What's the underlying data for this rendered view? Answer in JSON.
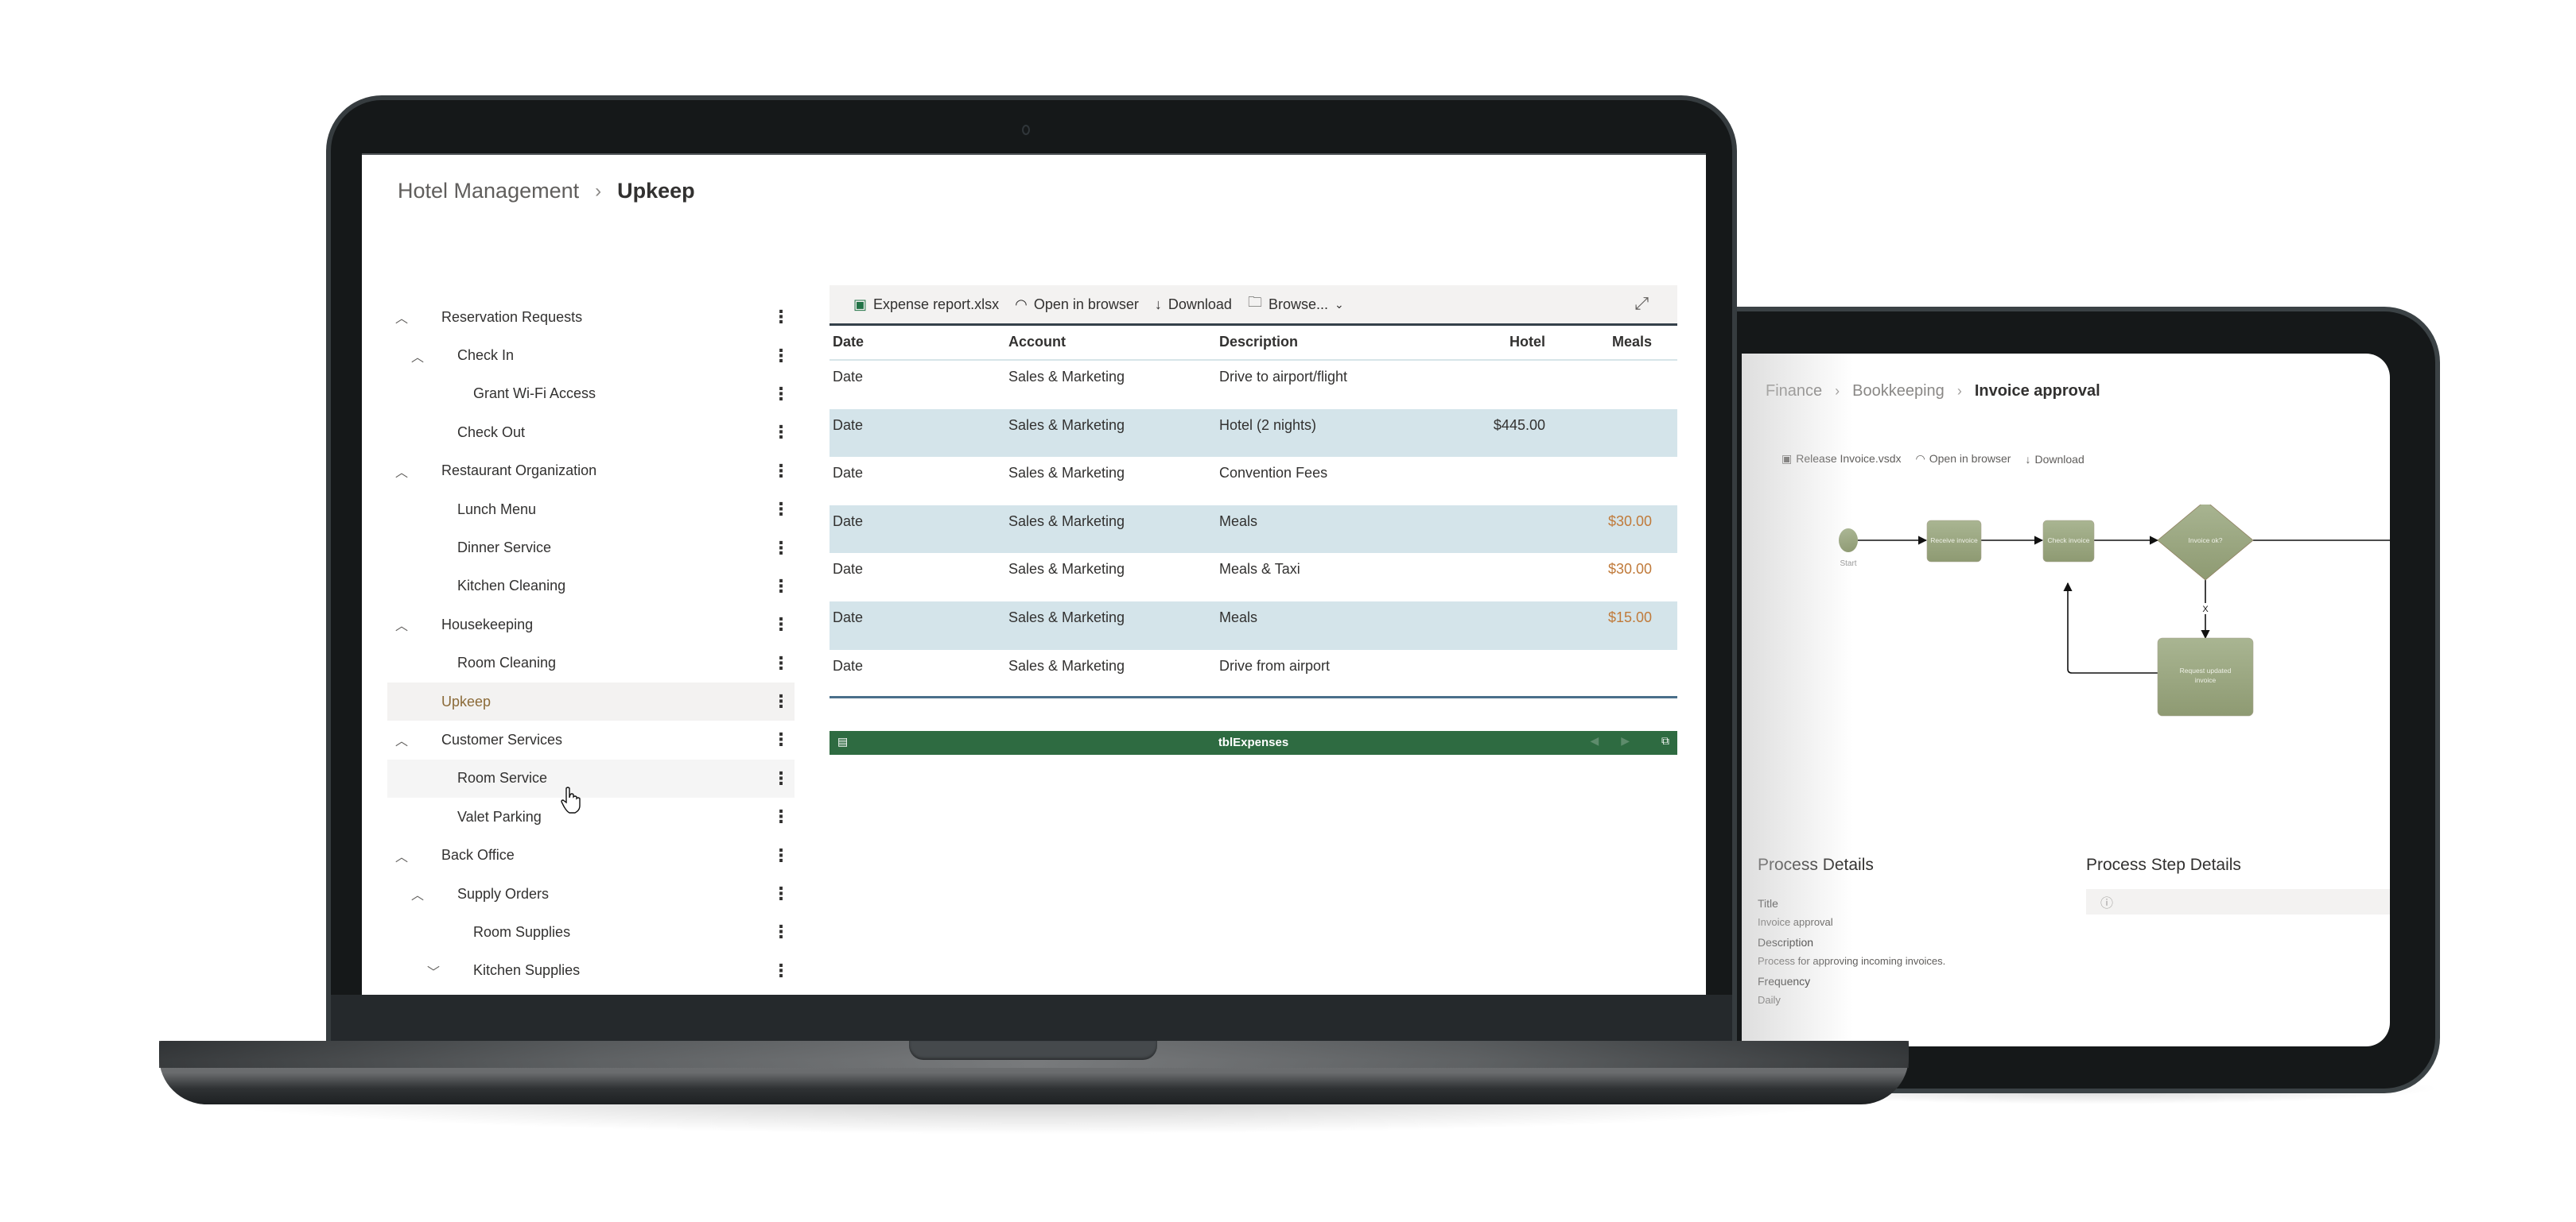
{
  "laptop": {
    "breadcrumb": {
      "parent": "Hotel Management",
      "separator": "›",
      "current": "Upkeep"
    },
    "tree": [
      {
        "label": "Reservation Requests",
        "level": 0,
        "chevron": "up"
      },
      {
        "label": "Check In",
        "level": 1,
        "chevron": "up"
      },
      {
        "label": "Grant Wi-Fi Access",
        "level": 2,
        "chevron": ""
      },
      {
        "label": "Check Out",
        "level": 1,
        "chevron": ""
      },
      {
        "label": "Restaurant Organization",
        "level": 0,
        "chevron": "up"
      },
      {
        "label": "Lunch Menu",
        "level": 1,
        "chevron": ""
      },
      {
        "label": "Dinner Service",
        "level": 1,
        "chevron": ""
      },
      {
        "label": "Kitchen Cleaning",
        "level": 1,
        "chevron": ""
      },
      {
        "label": "Housekeeping",
        "level": 0,
        "chevron": "up"
      },
      {
        "label": "Room Cleaning",
        "level": 1,
        "chevron": ""
      },
      {
        "label": "Upkeep",
        "level": 0,
        "chevron": "",
        "selected": true
      },
      {
        "label": "Customer Services",
        "level": 0,
        "chevron": "up"
      },
      {
        "label": "Room Service",
        "level": 1,
        "chevron": "",
        "hover": true
      },
      {
        "label": "Valet Parking",
        "level": 1,
        "chevron": ""
      },
      {
        "label": "Back Office",
        "level": 0,
        "chevron": "up"
      },
      {
        "label": "Supply Orders",
        "level": 1,
        "chevron": "up"
      },
      {
        "label": "Room Supplies",
        "level": 2,
        "chevron": ""
      },
      {
        "label": "Kitchen Supplies",
        "level": 2,
        "chevron": "down"
      }
    ],
    "more_glyph": "⋮",
    "excel": {
      "toolbar": {
        "file_name": "Expense report.xlsx",
        "open_in_browser": "Open in browser",
        "download": "Download",
        "browse": "Browse..."
      },
      "columns": [
        "Date",
        "Account",
        "Description",
        "Hotel",
        "Meals"
      ],
      "rows": [
        {
          "date": "Date",
          "account": "Sales & Marketing",
          "description": "Drive to airport/flight",
          "hotel": "",
          "meals": ""
        },
        {
          "date": "Date",
          "account": "Sales & Marketing",
          "description": "Hotel (2 nights)",
          "hotel": "$445.00",
          "meals": ""
        },
        {
          "date": "Date",
          "account": "Sales & Marketing",
          "description": "Convention Fees",
          "hotel": "",
          "meals": ""
        },
        {
          "date": "Date",
          "account": "Sales & Marketing",
          "description": "Meals",
          "hotel": "",
          "meals": "$30.00"
        },
        {
          "date": "Date",
          "account": "Sales & Marketing",
          "description": "Meals & Taxi",
          "hotel": "",
          "meals": "$30.00"
        },
        {
          "date": "Date",
          "account": "Sales & Marketing",
          "description": "Meals",
          "hotel": "",
          "meals": "$15.00"
        },
        {
          "date": "Date",
          "account": "Sales & Marketing",
          "description": "Drive from airport",
          "hotel": "",
          "meals": ""
        }
      ],
      "footer": {
        "sheet_name": "tblExpenses"
      },
      "colors": {
        "footer_bg": "#2e6b41",
        "alt_row": "#d4e4ea",
        "meals_value": "#c07a3a"
      }
    }
  },
  "tablet": {
    "breadcrumb": [
      "Finance",
      "Bookkeeping",
      "Invoice approval"
    ],
    "toolbar": {
      "file_name": "Release Invoice.vsdx",
      "open_in_browser": "Open in browser",
      "download": "Download"
    },
    "flow": {
      "start": "Start",
      "steps": [
        "Receive invoice",
        "Check invoice"
      ],
      "decision": "Invoice ok?",
      "reject_label": "X",
      "reject_step": "Request updated invoice",
      "node_color": "#9aa680"
    },
    "process_details": {
      "heading": "Process Details",
      "fields": [
        {
          "label": "Title",
          "value": "Invoice approval"
        },
        {
          "label": "Description",
          "value": "Process for approving incoming invoices."
        },
        {
          "label": "Frequency",
          "value": "Daily"
        }
      ]
    },
    "process_step_details": {
      "heading": "Process Step Details",
      "info_icon": "ⓘ"
    }
  }
}
